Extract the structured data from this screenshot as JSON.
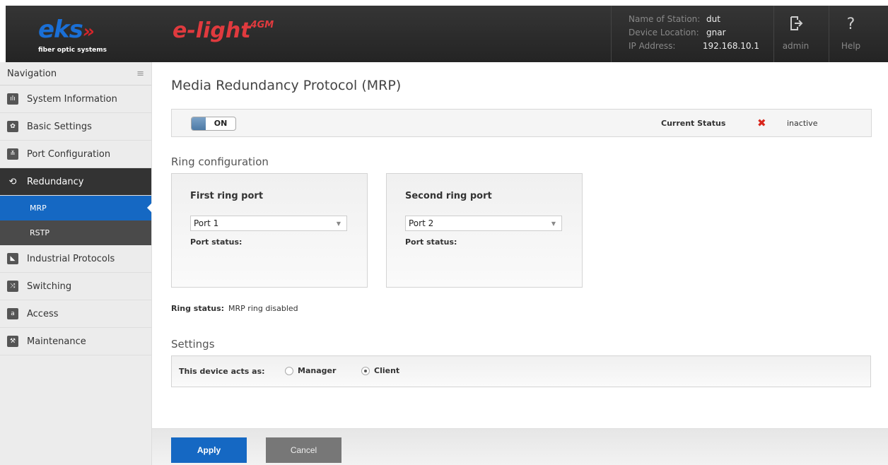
{
  "brand": {
    "logo_main": "eks",
    "logo_arrows": "»",
    "logo_sub": "fiber optic systems",
    "product": "e-light",
    "product_sup": "4GM"
  },
  "station": {
    "rows": [
      {
        "key": "Name of Station:",
        "value": "dut"
      },
      {
        "key": "Device Location:",
        "value": "gnar"
      },
      {
        "key": "IP Address:",
        "value": "192.168.10.1"
      }
    ]
  },
  "header_buttons": {
    "admin_label": "admin",
    "help_label": "Help",
    "admin_icon": "logout-icon",
    "help_icon": "question-icon"
  },
  "navigation": {
    "title": "Navigation",
    "items": [
      {
        "label": "System Information",
        "icon": "chart-icon",
        "glyph": "ılı"
      },
      {
        "label": "Basic Settings",
        "icon": "gear-icon",
        "glyph": "✿"
      },
      {
        "label": "Port Configuration",
        "icon": "ports-icon",
        "glyph": "≚"
      },
      {
        "label": "Redundancy",
        "icon": "redundancy-icon",
        "glyph": "⟲"
      },
      {
        "label": "Industrial Protocols",
        "icon": "industrial-icon",
        "glyph": "◣"
      },
      {
        "label": "Switching",
        "icon": "switch-icon",
        "glyph": "⤨"
      },
      {
        "label": "Access",
        "icon": "lock-icon",
        "glyph": "a"
      },
      {
        "label": "Maintenance",
        "icon": "wrench-icon",
        "glyph": "⚒"
      }
    ],
    "subitems": [
      {
        "label": "MRP"
      },
      {
        "label": "RSTP"
      }
    ]
  },
  "main": {
    "title": "Media Redundancy Protocol (MRP)",
    "toggle_label": "ON",
    "current_status_label": "Current Status",
    "current_status_icon": "✖",
    "current_status_value": "inactive",
    "ring_config_title": "Ring configuration",
    "rings": [
      {
        "title": "First ring port",
        "selected": "Port 1",
        "status_label": "Port status:"
      },
      {
        "title": "Second ring port",
        "selected": "Port 2",
        "status_label": "Port status:"
      }
    ],
    "ring_status_label": "Ring status:",
    "ring_status_value": "MRP ring disabled",
    "settings_title": "Settings",
    "acts_as_label": "This device acts as:",
    "role_options": [
      "Manager",
      "Client"
    ],
    "role_selected": "Client",
    "apply_label": "Apply",
    "cancel_label": "Cancel"
  },
  "colors": {
    "accent": "#1568c3",
    "error": "#d9261c",
    "header_bg": "#2c2c2c"
  }
}
